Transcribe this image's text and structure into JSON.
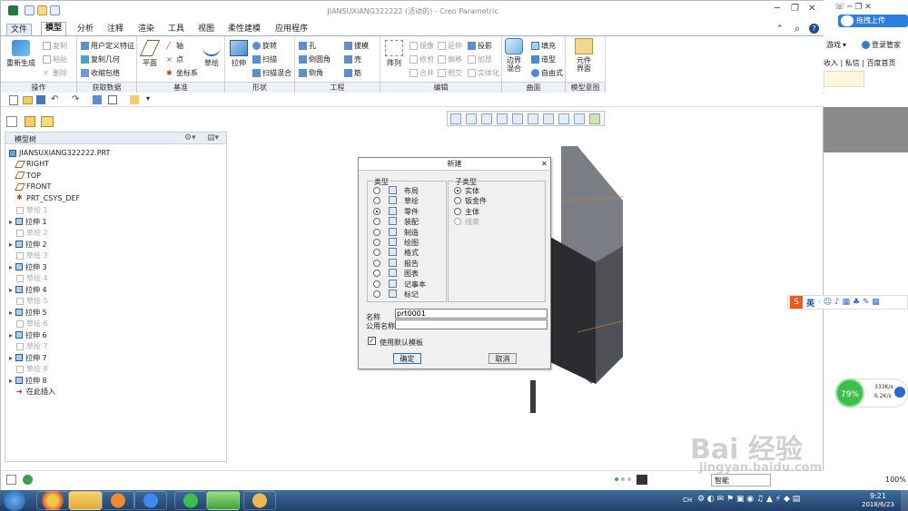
{
  "window": {
    "title": "JIANSUXIANG322222 (活动的) - Creo Parametric",
    "min": "─",
    "restore": "❐",
    "close": "✕"
  },
  "tabs": [
    "文件",
    "模型",
    "分析",
    "注释",
    "渲染",
    "工具",
    "视图",
    "柔性建模",
    "应用程序"
  ],
  "ribbon": {
    "ops": {
      "regen": "重新生成",
      "copy": "复制",
      "paste": "粘贴",
      "delete": "删除",
      "label": "操作"
    },
    "getdata": {
      "udf": "用户定义特征",
      "copygeom": "复制几何",
      "shrink": "收缩包络",
      "label": "获取数据"
    },
    "datum": {
      "plane": "平面",
      "axis": "轴",
      "point": "点",
      "csys": "坐标系",
      "sketch": "草绘",
      "label": "基准"
    },
    "shapes": {
      "extrude": "拉伸",
      "revolve": "旋转",
      "sweep": "扫描",
      "sweptblend": "扫描混合",
      "label": "形状"
    },
    "eng": {
      "hole": "孔",
      "draft": "拔模",
      "round": "倒圆角",
      "shell": "壳",
      "chamfer": "倒角",
      "rib": "筋",
      "label": "工程"
    },
    "edit": {
      "pattern": "阵列",
      "mirror": "镜像",
      "trim": "修剪",
      "merge": "合并",
      "extend": "延伸",
      "offset": "偏移",
      "intersect": "相交",
      "project": "投影",
      "thicken": "加厚",
      "solidify": "实体化",
      "label": "编辑"
    },
    "surface": {
      "boundary": "边界混合",
      "fill": "填充",
      "style": "造型",
      "freestyle": "自由式",
      "label": "曲面"
    },
    "intent": {
      "component": "元件界面",
      "label": "模型意图"
    }
  },
  "tree": {
    "header": "模型树",
    "root": "JIANSUXIANG322222.PRT",
    "items": [
      "RIGHT",
      "TOP",
      "FRONT",
      "PRT_CSYS_DEF",
      "草绘 1",
      "拉伸 1",
      "草绘 2",
      "拉伸 2",
      "草绘 3",
      "拉伸 3",
      "草绘 4",
      "拉伸 4",
      "草绘 5",
      "拉伸 5",
      "草绘 6",
      "拉伸 6",
      "草绘 7",
      "拉伸 7",
      "草绘 8",
      "拉伸 8",
      "在此插入"
    ]
  },
  "dialog": {
    "title": "新建",
    "type_label": "类型",
    "subtype_label": "子类型",
    "types": [
      "布局",
      "草绘",
      "零件",
      "装配",
      "制造",
      "绘图",
      "格式",
      "报告",
      "图表",
      "记事本",
      "标记"
    ],
    "selected_type": "零件",
    "subtypes": [
      "实体",
      "钣金件",
      "主体",
      "线束"
    ],
    "selected_subtype": "实体",
    "name_label": "名称",
    "name_value": "prt0001",
    "common_name_label": "公用名称",
    "common_name_value": "",
    "use_template": "使用默认模板",
    "ok": "确定",
    "cancel": "取消"
  },
  "right_panel": {
    "upload": "拖拽上传",
    "game": "游戏",
    "login": "登录管家",
    "row2": "收入 | 私信 | 百度首页",
    "ime": "英",
    "net_percent": "79%",
    "up": "333K/s",
    "down": "6.2K/s"
  },
  "status": {
    "smart": "智能",
    "zoom": "100%"
  },
  "taskbar": {
    "time": "9:21",
    "date": "2018/6/23",
    "ime": "CH"
  },
  "watermark": {
    "logo": "Bai 经验",
    "url": "jingyan.baidu.com"
  }
}
